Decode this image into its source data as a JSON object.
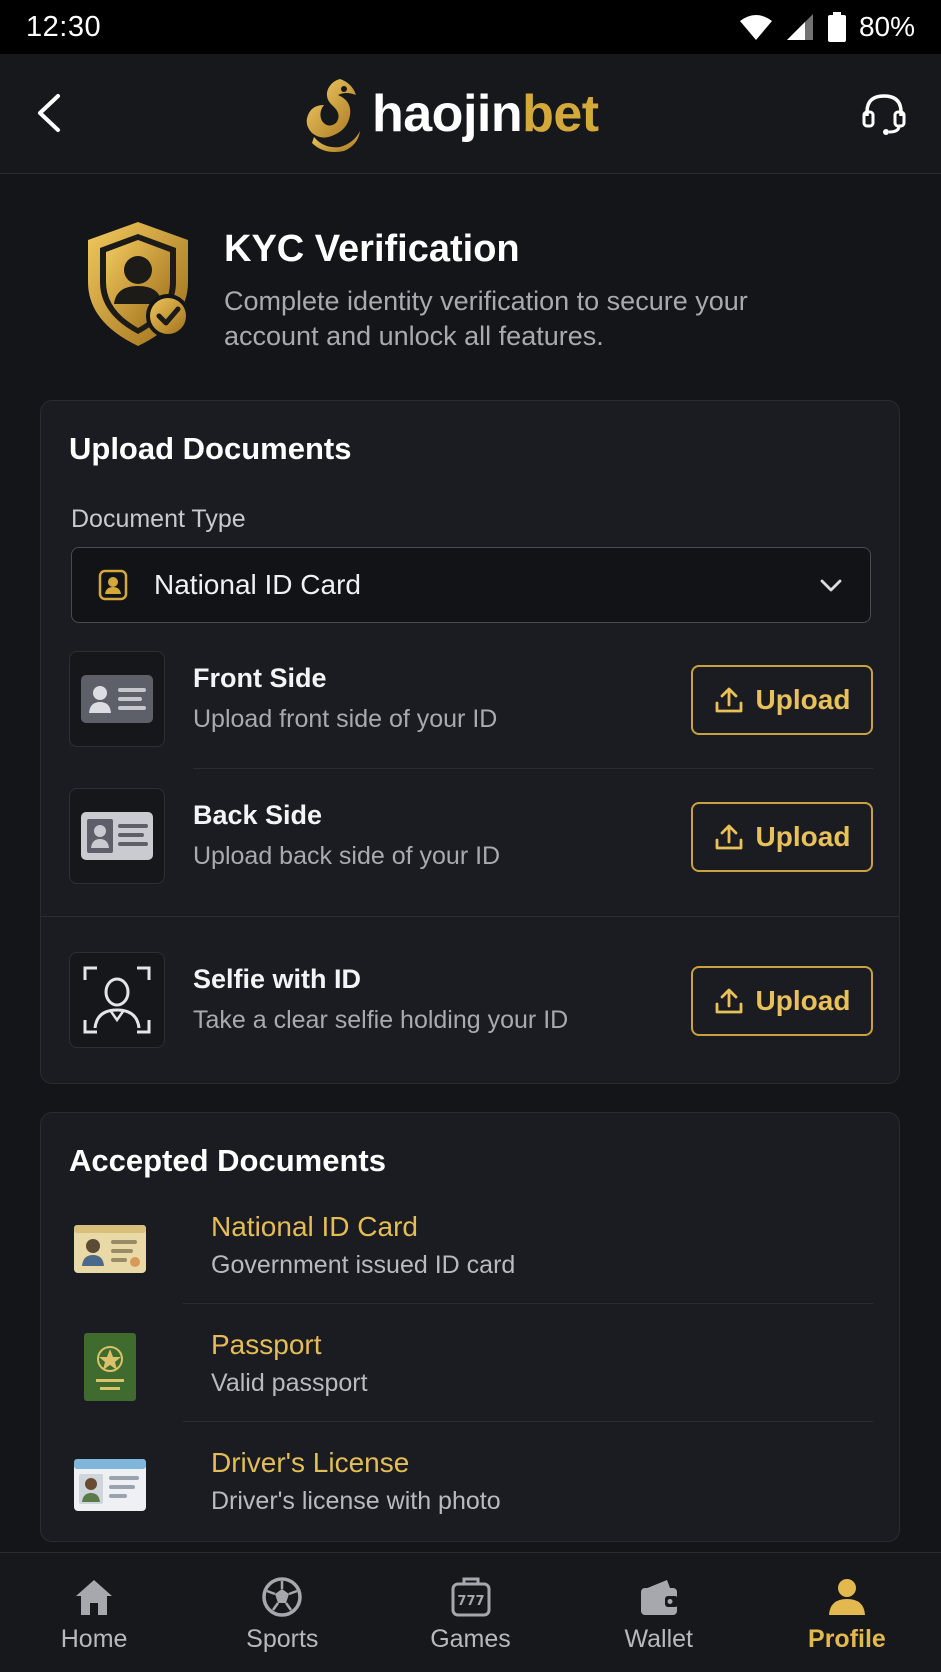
{
  "status_bar": {
    "time": "12:30",
    "battery": "80%"
  },
  "header": {
    "brand_part1": "haojin",
    "brand_part2": "bet"
  },
  "kyc": {
    "title": "KYC Verification",
    "description": "Complete identity verification to secure your account and unlock all features."
  },
  "upload": {
    "title": "Upload Documents",
    "doc_type_label": "Document Type",
    "doc_type_value": "National ID Card",
    "rows": [
      {
        "title": "Front Side",
        "subtitle": "Upload front side of your ID",
        "button": "Upload",
        "icon": "id-front-icon"
      },
      {
        "title": "Back Side",
        "subtitle": "Upload back side of your ID",
        "button": "Upload",
        "icon": "id-back-icon"
      },
      {
        "title": "Selfie with ID",
        "subtitle": "Take a clear selfie holding your ID",
        "button": "Upload",
        "icon": "selfie-icon"
      }
    ]
  },
  "accepted": {
    "title": "Accepted Documents",
    "items": [
      {
        "title": "National ID Card",
        "subtitle": "Government issued ID card",
        "icon": "id-card-icon"
      },
      {
        "title": "Passport",
        "subtitle": "Valid passport",
        "icon": "passport-icon"
      },
      {
        "title": "Driver's License",
        "subtitle": "Driver's license with photo",
        "icon": "drivers-license-icon"
      }
    ]
  },
  "nav": {
    "items": [
      {
        "label": "Home",
        "icon": "home-icon"
      },
      {
        "label": "Sports",
        "icon": "soccer-ball-icon"
      },
      {
        "label": "Games",
        "icon": "slot-machine-icon"
      },
      {
        "label": "Wallet",
        "icon": "wallet-icon"
      },
      {
        "label": "Profile",
        "icon": "profile-icon"
      }
    ],
    "active": "Profile"
  },
  "colors": {
    "accent": "#d4a93a",
    "background": "#141519",
    "card": "#1b1c21"
  }
}
